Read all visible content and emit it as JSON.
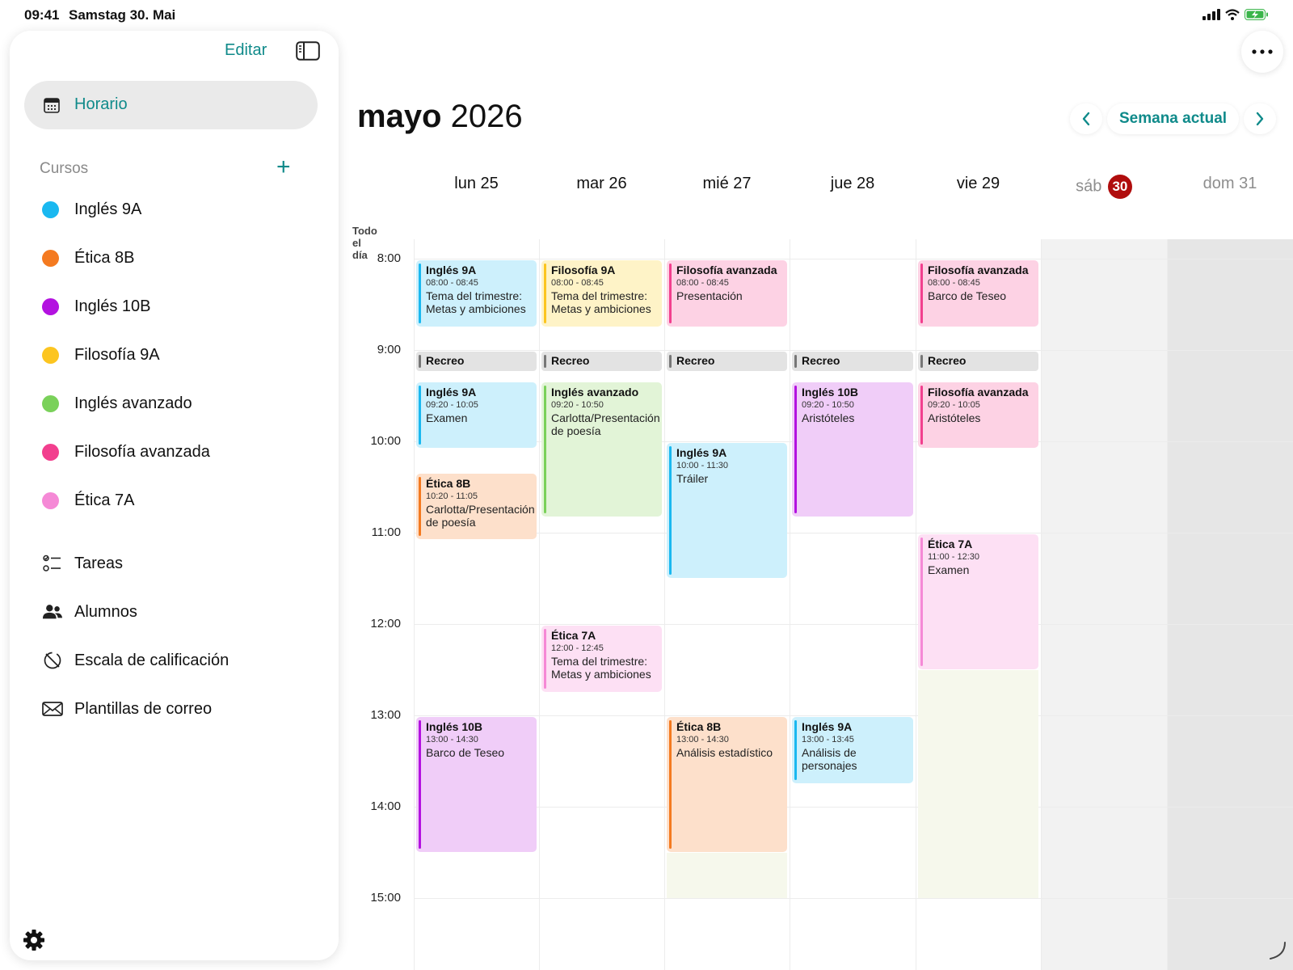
{
  "status": {
    "time": "09:41",
    "date": "Samstag 30. Mai"
  },
  "sidebar": {
    "edit": "Editar",
    "active": "Horario",
    "section": "Cursos",
    "courses": [
      {
        "label": "Inglés 9A",
        "color": "#1ab8f0"
      },
      {
        "label": "Ética 8B",
        "color": "#f47a20"
      },
      {
        "label": "Inglés 10B",
        "color": "#b312e0"
      },
      {
        "label": "Filosofía 9A",
        "color": "#fcc520"
      },
      {
        "label": "Inglés avanzado",
        "color": "#7ad15a"
      },
      {
        "label": "Filosofía avanzada",
        "color": "#f23f8e"
      },
      {
        "label": "Ética 7A",
        "color": "#f589d6"
      }
    ],
    "nav": [
      {
        "label": "Tareas",
        "icon": "checklist-icon"
      },
      {
        "label": "Alumnos",
        "icon": "people-icon"
      },
      {
        "label": "Escala de calificación",
        "icon": "grading-scale-icon"
      },
      {
        "label": "Plantillas de correo",
        "icon": "envelope-icon"
      }
    ]
  },
  "header": {
    "month": "mayo",
    "year": "2026",
    "current_week": "Semana actual"
  },
  "calendar": {
    "all_day_label": "Todo el día",
    "days": [
      {
        "label": "lun 25"
      },
      {
        "label": "mar 26"
      },
      {
        "label": "mié 27"
      },
      {
        "label": "jue 28"
      },
      {
        "label": "vie 29"
      },
      {
        "prefix": "sáb",
        "badge": "30"
      },
      {
        "label": "dom 31"
      }
    ],
    "hours": [
      "8:00",
      "9:00",
      "10:00",
      "11:00",
      "12:00",
      "13:00",
      "14:00",
      "15:00"
    ],
    "recess_label": "Recreo",
    "events": [
      {
        "day": 0,
        "title": "Inglés 9A",
        "time": "08:00 - 08:45",
        "desc": "Tema del trimestre: Metas y ambiciones",
        "course": 0
      },
      {
        "day": 0,
        "title": "Inglés 9A",
        "time": "09:20 - 10:05",
        "desc": "Examen",
        "course": 0
      },
      {
        "day": 0,
        "title": "Ética 8B",
        "time": "10:20 - 11:05",
        "desc": "Carlotta/Presentación de poesía",
        "course": 1
      },
      {
        "day": 0,
        "title": "Inglés 10B",
        "time": "13:00 - 14:30",
        "desc": "Barco de Teseo",
        "course": 2
      },
      {
        "day": 1,
        "title": "Filosofía 9A",
        "time": "08:00 - 08:45",
        "desc": "Tema del trimestre: Metas y ambiciones",
        "course": 3
      },
      {
        "day": 1,
        "title": "Inglés avanzado",
        "time": "09:20 - 10:50",
        "desc": "Carlotta/Presentación de poesía",
        "course": 4
      },
      {
        "day": 1,
        "title": "Ética 7A",
        "time": "12:00 - 12:45",
        "desc": "Tema del trimestre: Metas y ambiciones",
        "course": 6
      },
      {
        "day": 2,
        "title": "Filosofía avanzada",
        "time": "08:00 - 08:45",
        "desc": "Presentación",
        "course": 5
      },
      {
        "day": 2,
        "title": "Inglés 9A",
        "time": "10:00 - 11:30",
        "desc": "Tráiler",
        "course": 0
      },
      {
        "day": 2,
        "title": "Ética 8B",
        "time": "13:00 - 14:30",
        "desc": "Análisis estadístico",
        "course": 1
      },
      {
        "day": 3,
        "title": "Inglés 10B",
        "time": "09:20 - 10:50",
        "desc": "Aristóteles",
        "course": 2
      },
      {
        "day": 3,
        "title": "Inglés 9A",
        "time": "13:00 - 13:45",
        "desc": "Análisis de personajes",
        "course": 0
      },
      {
        "day": 4,
        "title": "Filosofía avanzada",
        "time": "08:00 - 08:45",
        "desc": "Barco de Teseo",
        "course": 5
      },
      {
        "day": 4,
        "title": "Filosofía avanzada",
        "time": "09:20 - 10:05",
        "desc": "Aristóteles",
        "course": 5
      },
      {
        "day": 4,
        "title": "Ética 7A",
        "time": "11:00 - 12:30",
        "desc": "Examen",
        "course": 6
      }
    ]
  }
}
